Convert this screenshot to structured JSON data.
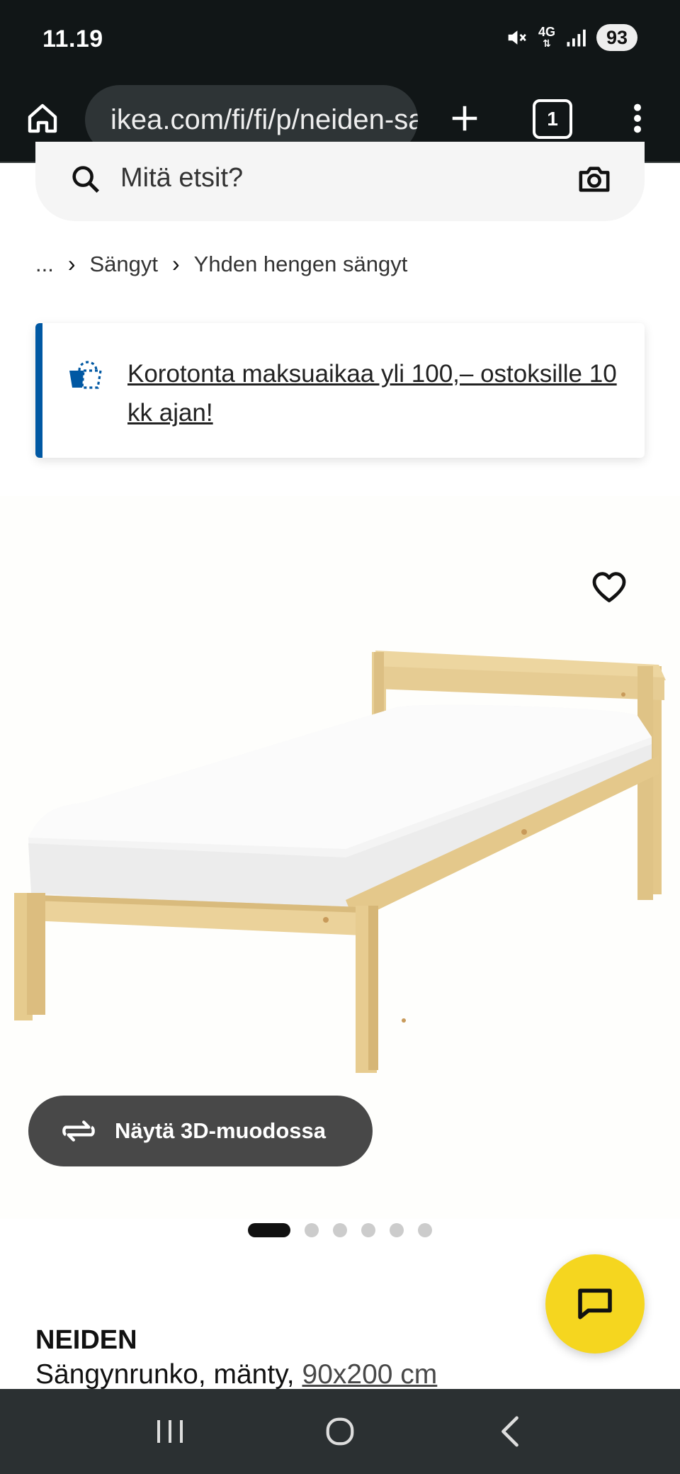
{
  "status": {
    "time": "11.19",
    "network": "4G",
    "battery": "93"
  },
  "browser": {
    "url": "ikea.com/fi/fi/p/neiden-sangynrunko-manty",
    "tab_count": "1"
  },
  "search": {
    "placeholder": "Mitä etsit?"
  },
  "breadcrumb": {
    "ellipsis": "...",
    "items": [
      "Sängyt",
      "Yhden hengen sängyt"
    ]
  },
  "promo": {
    "text": "Korotonta maksuaikaa yli 100,– ostoksille 10 kk ajan!"
  },
  "gallery": {
    "view_3d_label": "Näytä 3D-muodossa",
    "page_count": 6,
    "active_page": 1
  },
  "product": {
    "name": "NEIDEN",
    "description": "Sängynrunko, mänty,",
    "size": "90x200 cm"
  },
  "colors": {
    "ikea_blue": "#0058a3",
    "chat_yellow": "#f5d61f",
    "bar_dark": "#111617"
  },
  "icons": {
    "home": "home-icon",
    "site_settings": "tune-icon",
    "add_tab": "plus-icon",
    "menu": "more-vert-icon",
    "search": "search-icon",
    "camera": "camera-icon",
    "favorite": "heart-icon",
    "rotate_3d": "rotate-3d-icon",
    "chat": "chat-icon"
  }
}
